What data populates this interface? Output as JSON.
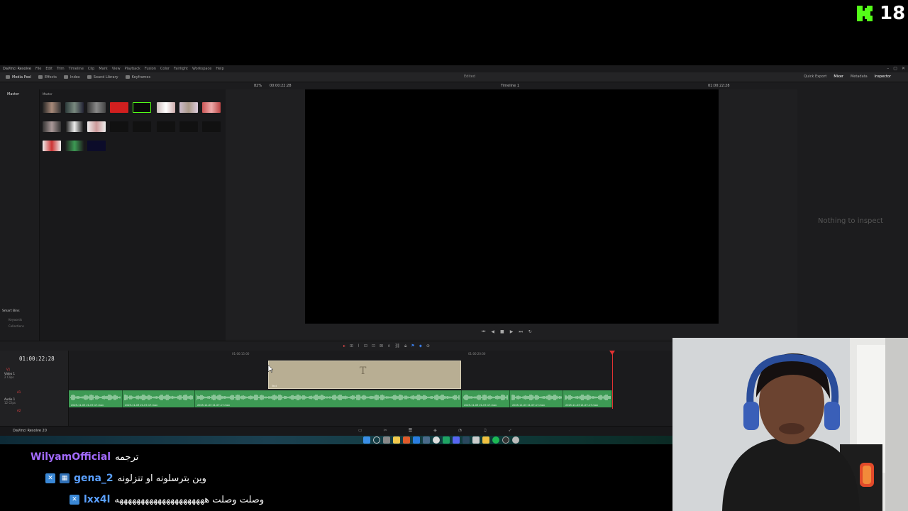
{
  "overlay": {
    "viewer_count": "18",
    "platform_icon": "kick-logo-icon",
    "accent": "#53fc18"
  },
  "app": {
    "title": "DaVinci Resolve",
    "menu": [
      "File",
      "Edit",
      "Trim",
      "Timeline",
      "Clip",
      "Mark",
      "View",
      "Playback",
      "Fusion",
      "Color",
      "Fairlight",
      "Workspace",
      "Help"
    ],
    "toolbar_left": [
      "Media Pool",
      "Effects",
      "Index",
      "Sound Library",
      "Keyframes"
    ],
    "toolbar_center": [
      "Edited"
    ],
    "toolbar_right": [
      "Quick Export",
      "Mixer",
      "Metadata",
      "Inspector"
    ],
    "zoom": "82%",
    "source_timecode": "00:00:22:28",
    "timeline_name": "Timeline 1",
    "record_timecode": "01:00:22:28",
    "footer_name": "DaVinci Resolve 20"
  },
  "media_pool": {
    "bin": "Master",
    "header": "Master",
    "smart_bins": "Smart Bins",
    "smart_items": [
      "Keywords",
      "Collections"
    ]
  },
  "inspector": {
    "empty_text": "Nothing to inspect"
  },
  "timeline": {
    "timecode": "01:00:22:28",
    "ruler": [
      "01:00:15:00",
      "01:00:20:00"
    ],
    "tracks": [
      {
        "id": "V1",
        "name": "Video 1",
        "clips": "2 Clips"
      },
      {
        "id": "A1",
        "name": "Audio 1",
        "clips": "12 Clips"
      },
      {
        "id": "A2",
        "name": "Audio 2"
      }
    ],
    "title_clip": {
      "glyph": "T",
      "label": "Text"
    },
    "audio_clip_label": "2025-11-03 21-07-17.mov"
  },
  "chat": [
    {
      "user": "WilyamOfficial",
      "color": "#a36bff",
      "message": "ترجمه"
    },
    {
      "user": "gena_2",
      "color": "#5aa0ff",
      "message": "وين بترسلونه او تنزلونه"
    },
    {
      "user": "lxx4l",
      "color": "#5aa0ff",
      "message": "وصلت وصلت هههههههههههههههههههههه"
    }
  ]
}
